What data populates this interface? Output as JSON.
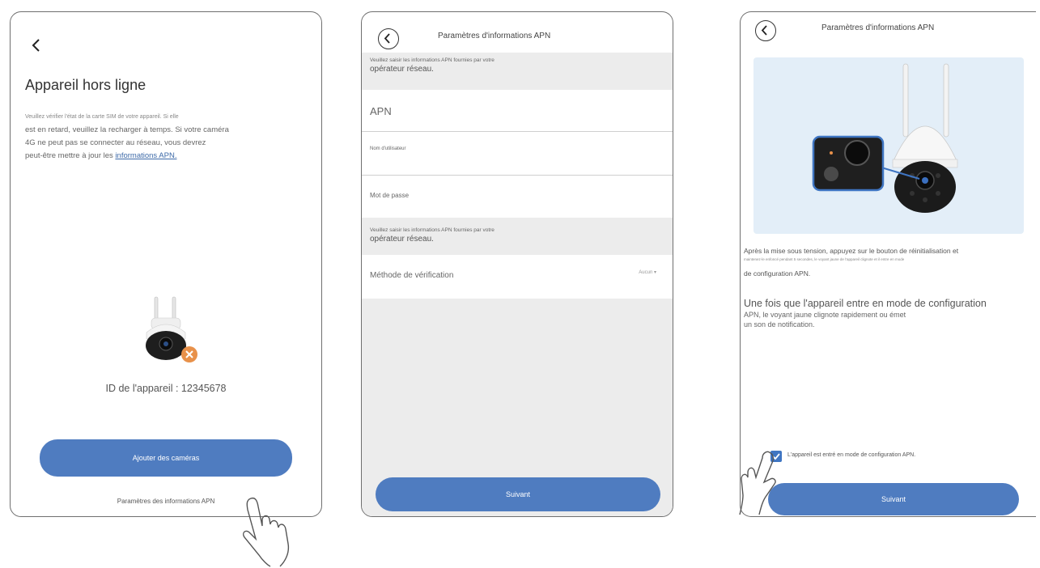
{
  "screen1": {
    "title": "Appareil hors ligne",
    "intro": "Veuillez vérifier l'état de la carte SIM de votre appareil. Si elle",
    "line2": "est en retard, veuillez la recharger à temps. Si votre caméra",
    "line3": "4G ne peut pas se connecter au réseau, vous devrez",
    "line4_prefix": "peut-être mettre à jour les ",
    "line4_link": "informations APN.",
    "device_id": "ID de l'appareil : 12345678",
    "add_button": "Ajouter des caméras",
    "apn_link": "Paramètres des informations APN"
  },
  "screen2": {
    "title": "Paramètres d'informations APN",
    "band1_small": "Veuillez saisir les informations APN fournies par votre",
    "band1_big": "opérateur réseau.",
    "apn_label": "APN",
    "username_label": "Nom d'utilisateur",
    "password_label": "Mot de passe",
    "band2_small": "Veuillez saisir les informations APN fournies par votre",
    "band2_big": "opérateur réseau.",
    "verification_label": "Méthode de vérification",
    "verification_value": "Aucun",
    "next_button": "Suivant"
  },
  "screen3": {
    "title": "Paramètres d'informations APN",
    "text1": "Après la mise sous tension, appuyez sur le bouton de réinitialisation et",
    "text1_tiny": "maintenez-le enfoncé pendant 5 secondes, le voyant jaune de l'appareil clignote et il entre en mode",
    "text1_end": "de configuration APN.",
    "text2": "Une fois que l'appareil entre en mode de configuration",
    "text3a": "APN, le voyant jaune clignote rapidement ou émet",
    "text3b": "un son de notification.",
    "checkbox_label": "L'appareil est entré en mode de configuration APN.",
    "next_button": "Suivant"
  },
  "colors": {
    "accent": "#4f7cc0",
    "status_offline": "#e8914a",
    "band": "#ececec",
    "illustration_bg": "#e3eef8"
  }
}
